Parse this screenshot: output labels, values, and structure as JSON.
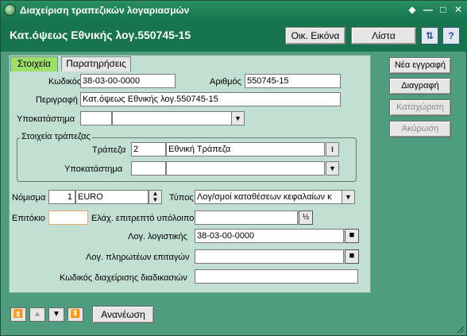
{
  "window": {
    "title": "Διαχείριση τραπεζικών λογαριασμών",
    "controls": [
      "◆",
      "—",
      "□",
      "✕"
    ]
  },
  "header": {
    "title": "Κατ.όψεως Εθνικής λογ.550745-15",
    "ecn_button": "Οικ. Εικόνα",
    "list_button": "Λίστα"
  },
  "tabs": [
    {
      "label": "Στοιχεία",
      "active": true
    },
    {
      "label": "Παρατηρήσεις",
      "active": false
    }
  ],
  "form": {
    "code_label": "Κωδικός",
    "code_value": "38-03-00-0000",
    "number_label": "Αριθμός",
    "number_value": "550745-15",
    "description_label": "Περιγραφή",
    "description_value": "Κατ.όψεως Εθνικής λογ.550745-15",
    "branch_label": "Υποκατάστημα",
    "branch_code": "",
    "branch_name": "",
    "bank_group": {
      "legend": "Στοιχεία τράπεζας",
      "bank_label": "Τράπεζα",
      "bank_code": "2",
      "bank_name": "Εθνική Τράπεζα",
      "branch_label": "Υποκατάστημα",
      "branch_code": "",
      "branch_name": ""
    },
    "currency_label": "Νόμισμα",
    "currency_code": "1",
    "currency_name": "EURO",
    "type_label": "Τύπος",
    "type_value": "Λογ/σμοί καταθέσεων κεφαλαίων κ",
    "interest_label": "Επιτόκιο",
    "interest_value": "",
    "min_balance_label": "Ελάχ. επιτρεπτό υπόλοιπο",
    "min_balance_value": "",
    "accounting_label": "Λογ. λογιστικής",
    "accounting_value": "38-03-00-0000",
    "payment_orders_label": "Λογ. πληρωτέων επιταγών",
    "payment_orders_value": "",
    "process_code_label": "Κωδικός διαχείρισης διαδικασιών",
    "process_code_value": ""
  },
  "side_buttons": {
    "new": "Νέα εγγραφή",
    "delete": "Διαγραφή",
    "save": "Καταχώριση",
    "cancel": "Ακύρωση"
  },
  "bottom": {
    "refresh": "Ανανέωση"
  }
}
